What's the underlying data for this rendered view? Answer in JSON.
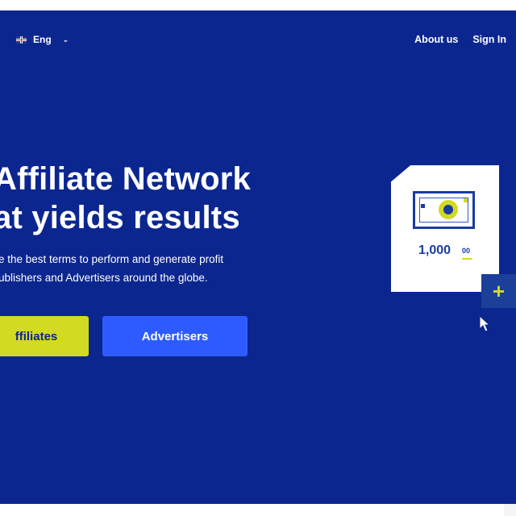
{
  "header": {
    "language": {
      "flag_icon": "uk-flag-icon",
      "label": "Eng",
      "chevron": "⌄"
    },
    "nav": [
      {
        "label": "About us"
      },
      {
        "label": "Sign In"
      }
    ]
  },
  "hero": {
    "headline_lines": [
      "Affiliate Network",
      "at yields results"
    ],
    "subtext_lines": [
      "e the best terms to perform and generate profit",
      "ublishers and Advertisers around the globe."
    ],
    "buttons": {
      "affiliates": "ffiliates",
      "advertisers": "Advertisers"
    }
  },
  "illustration": {
    "amount": "1,000",
    "cents": "00",
    "plus": "+",
    "icons": [
      "banknote-icon",
      "plus-icon",
      "mouse-cursor-icon"
    ]
  },
  "colors": {
    "background": "#0c2690",
    "accent_yellow": "#d3da22",
    "button_blue": "#2e5bff",
    "card_white": "#ffffff"
  }
}
